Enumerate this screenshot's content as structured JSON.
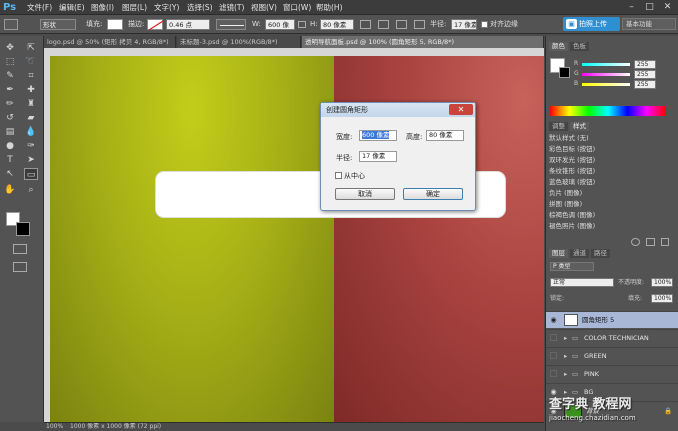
{
  "app": {
    "logo": "Ps"
  },
  "menu": [
    "文件(F)",
    "编辑(E)",
    "图像(I)",
    "图层(L)",
    "文字(Y)",
    "选择(S)",
    "滤镜(T)",
    "视图(V)",
    "窗口(W)",
    "帮助(H)"
  ],
  "window_controls": {
    "minimize": "–",
    "maximize": "□",
    "close": "✕"
  },
  "options_bar": {
    "shape_mode": "形状",
    "fill_label": "填充:",
    "stroke_label": "描边:",
    "stroke_width": "0.46 点",
    "w_label": "W:",
    "w_value": "600 像",
    "h_label": "H:",
    "h_value": "80 像素",
    "radius_label": "半径:",
    "radius_value": "17 像素",
    "align_edges_label": "对齐边缘",
    "upload_button": "拍照上传",
    "workspace": "基本功能"
  },
  "doc_tabs": [
    {
      "label": "logo.psd @ 50% (矩形 拷贝 4, RGB/8*)",
      "active": false
    },
    {
      "label": "未标题-3.psd @ 100%(RGB/8*)",
      "active": false
    },
    {
      "label": "透明导航面板.psd @ 100% (圆角矩形 5, RGB/8*)",
      "active": true
    }
  ],
  "dialog": {
    "title": "创建圆角矩形",
    "close": "✕",
    "width_label": "宽度:",
    "width_value": "600 像素",
    "height_label": "高度:",
    "height_value": "80 像素",
    "radius_label": "半径:",
    "radius_value": "17 像素",
    "from_center_label": "从中心",
    "cancel_button": "取消",
    "ok_button": "确定"
  },
  "status_bar": {
    "zoom": "100%",
    "doc_info": "1000 像素 x 1000 像素 (72 ppi)"
  },
  "color_panel": {
    "tabs": [
      "颜色",
      "色板"
    ],
    "r_label": "R",
    "r_value": "255",
    "g_label": "G",
    "g_value": "255",
    "b_label": "B",
    "b_value": "255"
  },
  "styles_panel": {
    "tabs": [
      "调整",
      "样式"
    ],
    "items": [
      "默认样式 (无)",
      "彩色目标 (按钮)",
      "双环发光 (按钮)",
      "条纹锥形 (按钮)",
      "蓝色玻璃 (按钮)",
      "负片 (图像)",
      "拼图 (图像)",
      "棕褐色调 (图像)",
      "褪色照片 (图像)"
    ]
  },
  "layers_panel": {
    "tabs": [
      "图层",
      "通道",
      "路径"
    ],
    "filter_label": "P 类型",
    "blend_mode": "正常",
    "opacity_label": "不透明度:",
    "opacity_value": "100%",
    "lock_label": "锁定:",
    "fill_label": "填充:",
    "fill_value": "100%",
    "layers": [
      {
        "name": "圆角矩形 5",
        "selected": true,
        "type": "shape"
      },
      {
        "name": "COLOR TECHNICIAN",
        "selected": false,
        "type": "group"
      },
      {
        "name": "GREEN",
        "selected": false,
        "type": "group"
      },
      {
        "name": "PINK",
        "selected": false,
        "type": "group"
      },
      {
        "name": "BG",
        "selected": false,
        "type": "group"
      },
      {
        "name": "背景",
        "selected": false,
        "type": "background"
      }
    ]
  },
  "watermark": {
    "line1": "查字典 教程网",
    "line2": "jiaocheng.chazidian.com"
  },
  "colors": {
    "accent": "#2e8fd3",
    "canvas_left": "#b5c018",
    "canvas_right": "#a5413e"
  }
}
